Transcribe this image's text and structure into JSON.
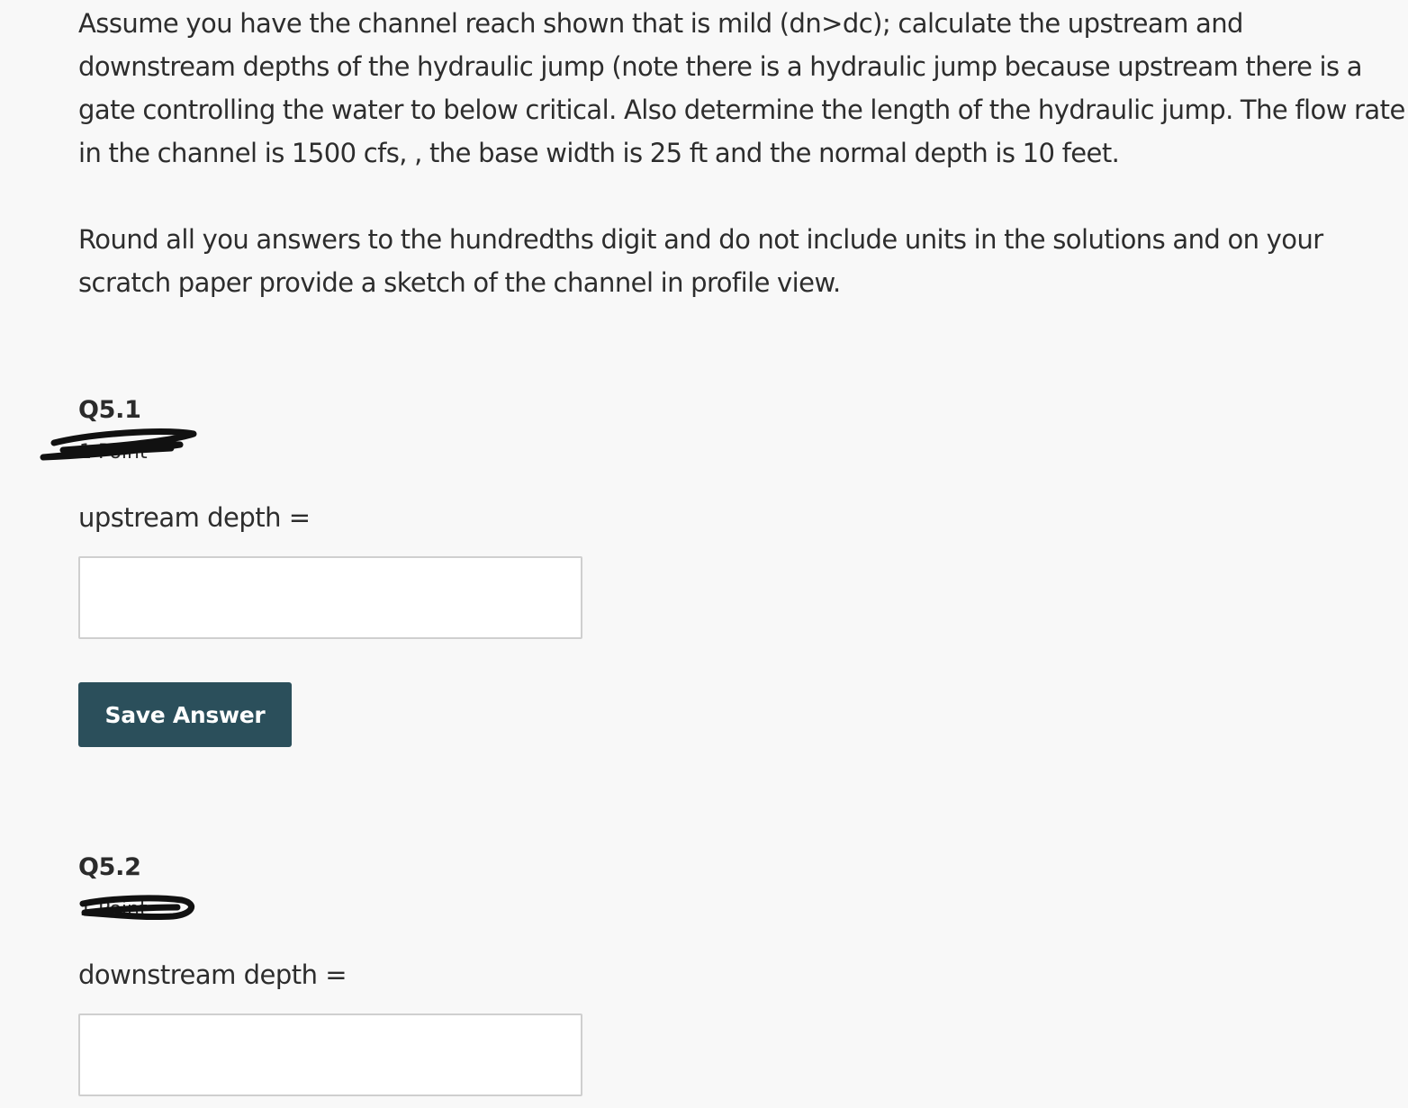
{
  "question": {
    "paragraph_1": "Assume you have the channel reach shown that is mild (dn>dc); calculate the upstream and downstream depths of the hydraulic jump (note there is a hydraulic jump because upstream there is a gate controlling the water to below critical. Also determine the length of the hydraulic jump. The flow rate in the channel is 1500 cfs, , the base width is 25 ft and the normal depth is 10 feet.",
    "paragraph_2": " Round all you answers to the hundredths digit and do not include units in the solutions and on your scratch paper provide a sketch of the channel in profile view."
  },
  "q5_1": {
    "title": "Q5.1",
    "points": "1 Point",
    "label": "upstream depth =",
    "value": "",
    "save_label": "Save Answer"
  },
  "q5_2": {
    "title": "Q5.2",
    "points": "1 Point",
    "label": "downstream depth =",
    "value": ""
  },
  "colors": {
    "background": "#f8f8f8",
    "text": "#2d2d2d",
    "button": "#2b4f5b",
    "input_border": "#cfcfcf"
  }
}
